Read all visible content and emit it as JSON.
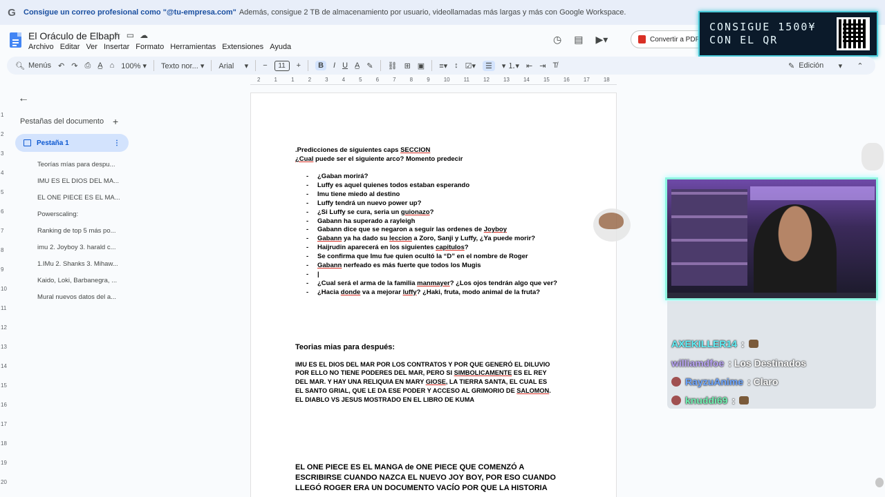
{
  "promo": {
    "logo": "G",
    "bold_text": "Consigue un correo profesional como \"@tu-empresa.com\"",
    "text": "Además, consigue 2 TB de almacenamiento por usuario, videollamadas más largas y más con Google Workspace."
  },
  "header": {
    "title": "El Oráculo de Elbaph",
    "menus": [
      "Archivo",
      "Editar",
      "Ver",
      "Insertar",
      "Formato",
      "Herramientas",
      "Extensiones",
      "Ayuda"
    ],
    "pdf_button": "Convertir a PDF"
  },
  "overlay_promo": {
    "line1": "CONSIGUE 1500¥",
    "line2": "CON EL QR"
  },
  "toolbar": {
    "menus_label": "Menús",
    "zoom": "100%",
    "style": "Texto nor...",
    "font": "Arial",
    "font_size": "11",
    "mode": "Edición"
  },
  "ruler_h": [
    "2",
    "1",
    "1",
    "2",
    "3",
    "4",
    "5",
    "6",
    "7",
    "8",
    "9",
    "10",
    "11",
    "12",
    "13",
    "14",
    "15",
    "16",
    "17",
    "18"
  ],
  "ruler_v": [
    "1",
    "2",
    "3",
    "4",
    "5",
    "6",
    "7",
    "8",
    "9",
    "10",
    "11",
    "12",
    "13",
    "14",
    "15",
    "16",
    "17",
    "18",
    "19",
    "20"
  ],
  "sidebar": {
    "tabs_heading": "Pestañas del documento",
    "active_tab": "Pestaña 1",
    "outline": [
      "Teorías mías para despu...",
      "IMU ES EL DIOS DEL MA...",
      "EL ONE PIECE ES EL MA...",
      "Powerscaling:",
      "Ranking de top 5 más po...",
      "imu 2. Joyboy 3. harald c...",
      "1.IMu 2. Shanks 3. Mihaw...",
      "Kaido, Loki, Barbanegra, ...",
      "Mural nuevos datos del a..."
    ]
  },
  "document": {
    "line1_pre": ".Predicciones de siguientes caps ",
    "line1_u": "SECCION",
    "line2_u": "¿Cual",
    "line2_post": " puede ser el siguiente arco? Momento predecir",
    "b1": "¿Gaban morirá?",
    "b2": "Luffy es aquel quienes todos estaban esperando",
    "b3": "Imu tiene miedo al destino",
    "b4": "Luffy tendrá un nuevo power up?",
    "b5_pre": "¿Si Luffy se cura, seria un ",
    "b5_u": "guionazo",
    "b5_post": "?",
    "b6": "Gabann ha superado a rayleigh",
    "b7_pre": "Gabann dice que se negaron a seguir las ordenes de ",
    "b7_u": "Joyboy",
    "b8_u1": "Gabann",
    "b8_mid": " ya ha dado su ",
    "b8_u2": "leccion",
    "b8_post": " a Zoro, Sanji y Luffy, ¿Ya puede morir?",
    "b9_pre": "Haijrudin aparecerá en los siguientes ",
    "b9_u": "capitulos",
    "b9_post": "?",
    "b10": "Se confirma que Imu fue quien ocultó la “D” en el nombre de Roger",
    "b11_u": "Gabann",
    "b11_post": " nerfeado es más fuerte que todos los Mugis",
    "b12": "|",
    "b13_pre": "¿Cual será el arma de la familia ",
    "b13_u": "manmayer",
    "b13_post": "? ¿Los ojos tendrán algo que ver?",
    "b14_pre": "¿Hacia ",
    "b14_u1": "donde",
    "b14_mid": " va a mejorar ",
    "b14_u2": "luffy",
    "b14_post": "? ¿Haki, fruta, modo animal de la fruta?",
    "h2": "Teorias mias para después:",
    "p1a": "IMU ES EL DIOS DEL MAR POR LOS CONTRATOS Y POR QUE GENERÓ EL DILUVIO",
    "p1b_pre": "POR ELLO NO TIENE PODERES DEL MAR, PERO SI ",
    "p1b_u": "SIMBOLICAMENTE",
    "p1b_post": " ES EL REY",
    "p1c_pre": "DEL MAR. Y HAY UNA RELIQUIA EN MARY ",
    "p1c_u": "GIOSE",
    "p1c_post": ", LA TIERRA SANTA, EL CUAL ES",
    "p1d_pre": "EL SANTO GRIAL, QUE LE DA ESE PODER Y ACCESO AL GRIMORIO DE ",
    "p1d_u": "SALOMON",
    "p1d_post": ".",
    "p1e": "EL DIABLO VS JESUS MOSTRADO EN EL LIBRO DE KUMA",
    "p2a": "EL ONE PIECE ES EL MANGA de ONE PIECE QUE COMENZÓ A",
    "p2b": "ESCRIBIRSE CUANDO NAZCA EL NUEVO JOY BOY, POR ESO CUANDO",
    "p2c": "LLEGÓ ROGER ERA UN DOCUMENTO VACÍO POR QUE LA HISTORIA"
  },
  "chat": [
    {
      "user": "AXEKILLER14",
      "text": " : "
    },
    {
      "user": "williamdfoe",
      "text": " : Los Destinados"
    },
    {
      "user": "RayzuAnime",
      "text": " : Claro"
    },
    {
      "user": "knuddi69",
      "text": " : "
    }
  ]
}
